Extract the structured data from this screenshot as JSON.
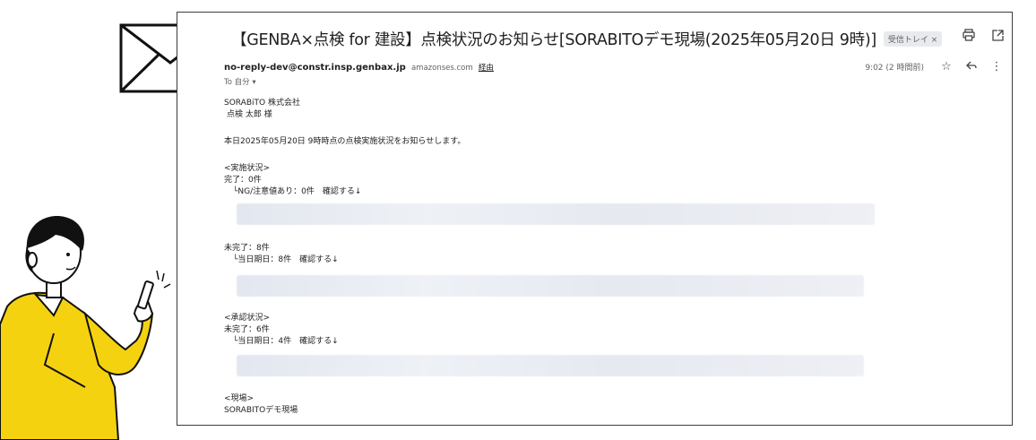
{
  "email": {
    "subject": "【GENBA×点検 for 建設】点検状況のお知らせ[SORABITOデモ現場(2025年05月20日 9時)]",
    "label_chip": "受信トレイ ×",
    "sender_name": "no-reply-dev@constr.insp.genbax.jp",
    "sender_domain": "amazonses.com",
    "via": "経由",
    "to_line": "To 自分 ▾",
    "time": "9:02 (2 時間前)",
    "icons": {
      "print": "print-icon",
      "open_new": "open-in-new-icon",
      "star": "star-icon",
      "reply": "reply-icon",
      "more": "more-vert-icon"
    },
    "body": {
      "company": "SORABiTO 株式会社",
      "recipient": "点検 太郎 様",
      "intro": "本日2025年05月20日 9時時点の点検実施状況をお知らせします。",
      "section1_header": "<実施状況>",
      "completed": "完了：0件",
      "ng_line": "└NG/注意値あり：0件　確認する↓",
      "incomplete": "未完了：8件",
      "due_line1": "└当日期日：8件　確認する↓",
      "section2_header": "<承認状況>",
      "approval_incomplete": "未完了：6件",
      "due_line2": "└当日期日：4件　確認する↓",
      "site_header": "<現場>",
      "site_name": "SORABITOデモ現場"
    }
  }
}
